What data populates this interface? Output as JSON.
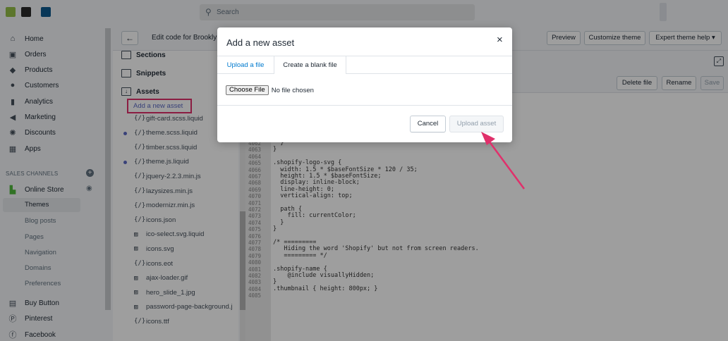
{
  "topbar": {
    "search_placeholder": "Search",
    "logo_colors": [
      "#95bf47",
      "#2b2b2b",
      "#0d5a8f"
    ]
  },
  "sidebar": {
    "items": [
      {
        "label": "Home",
        "icon": "home-icon"
      },
      {
        "label": "Orders",
        "icon": "orders-icon"
      },
      {
        "label": "Products",
        "icon": "tag-icon"
      },
      {
        "label": "Customers",
        "icon": "person-icon"
      },
      {
        "label": "Analytics",
        "icon": "bar-chart-icon"
      },
      {
        "label": "Marketing",
        "icon": "megaphone-icon"
      },
      {
        "label": "Discounts",
        "icon": "discount-icon"
      },
      {
        "label": "Apps",
        "icon": "apps-icon"
      }
    ],
    "sales_channels_label": "SALES CHANNELS",
    "online_store_label": "Online Store",
    "online_store_sub": [
      "Themes",
      "Blog posts",
      "Pages",
      "Navigation",
      "Domains",
      "Preferences"
    ],
    "bottom_items": [
      {
        "label": "Buy Button",
        "icon": "buy-button-icon"
      },
      {
        "label": "Pinterest",
        "icon": "pinterest-icon"
      },
      {
        "label": "Facebook",
        "icon": "facebook-icon"
      }
    ]
  },
  "editor": {
    "title": "Edit code for Brookly",
    "preview": "Preview",
    "customize": "Customize theme",
    "expert_help": "Expert theme help",
    "delete_file": "Delete file",
    "rename": "Rename",
    "save": "Save"
  },
  "filetree": {
    "sections": [
      "Sections",
      "Snippets",
      "Assets"
    ],
    "add_asset": "Add a new asset",
    "files": [
      {
        "name": "gift-card.scss.liquid",
        "type": "code",
        "dot": false
      },
      {
        "name": "theme.scss.liquid",
        "type": "code",
        "dot": true
      },
      {
        "name": "timber.scss.liquid",
        "type": "code",
        "dot": false
      },
      {
        "name": "theme.js.liquid",
        "type": "code",
        "dot": true
      },
      {
        "name": "jquery-2.2.3.min.js",
        "type": "code",
        "dot": false
      },
      {
        "name": "lazysizes.min.js",
        "type": "code",
        "dot": false
      },
      {
        "name": "modernizr.min.js",
        "type": "code",
        "dot": false
      },
      {
        "name": "icons.json",
        "type": "code",
        "dot": false
      },
      {
        "name": "ico-select.svg.liquid",
        "type": "image",
        "dot": false
      },
      {
        "name": "icons.svg",
        "type": "image",
        "dot": false
      },
      {
        "name": "icons.eot",
        "type": "code",
        "dot": false
      },
      {
        "name": "ajax-loader.gif",
        "type": "image",
        "dot": false
      },
      {
        "name": "hero_slide_1.jpg",
        "type": "image",
        "dot": false
      },
      {
        "name": "password-page-background.j",
        "type": "image",
        "dot": false
      },
      {
        "name": "icons.ttf",
        "type": "code",
        "dot": false
      }
    ]
  },
  "code": {
    "lines": [
      {
        "n": "4062",
        "t": "  }"
      },
      {
        "n": "4063",
        "t": "}"
      },
      {
        "n": "4064",
        "t": ""
      },
      {
        "n": "4065",
        "t": ".shopify-logo-svg {"
      },
      {
        "n": "4066",
        "t": "  width: 1.5 * $baseFontSize * 120 / 35;"
      },
      {
        "n": "4067",
        "t": "  height: 1.5 * $baseFontSize;"
      },
      {
        "n": "4068",
        "t": "  display: inline-block;"
      },
      {
        "n": "4069",
        "t": "  line-height: 0;"
      },
      {
        "n": "4070",
        "t": "  vertical-align: top;"
      },
      {
        "n": "4071",
        "t": ""
      },
      {
        "n": "4072",
        "t": "  path {"
      },
      {
        "n": "4073",
        "t": "    fill: currentColor;"
      },
      {
        "n": "4074",
        "t": "  }"
      },
      {
        "n": "4075",
        "t": "}"
      },
      {
        "n": "4076",
        "t": ""
      },
      {
        "n": "4077",
        "t": "/* ========="
      },
      {
        "n": "4078",
        "t": "   Hiding the word 'Shopify' but not from screen readers."
      },
      {
        "n": "4079",
        "t": "   ========= */"
      },
      {
        "n": "4080",
        "t": ""
      },
      {
        "n": "4081",
        "t": ".shopify-name {"
      },
      {
        "n": "4082",
        "t": "    @include visuallyHidden;"
      },
      {
        "n": "4083",
        "t": "}"
      },
      {
        "n": "4084",
        "t": ".thumbnail { height: 800px; }"
      },
      {
        "n": "4085",
        "t": ""
      }
    ]
  },
  "modal": {
    "title": "Add a new asset",
    "close": "×",
    "tab_upload": "Upload a file",
    "tab_blank": "Create a blank file",
    "choose_file": "Choose File",
    "no_file": "No file chosen",
    "cancel": "Cancel",
    "upload": "Upload asset"
  },
  "colors": {
    "highlight": "#e0306b",
    "accent": "#007ace",
    "link": "#5c6ac4"
  }
}
